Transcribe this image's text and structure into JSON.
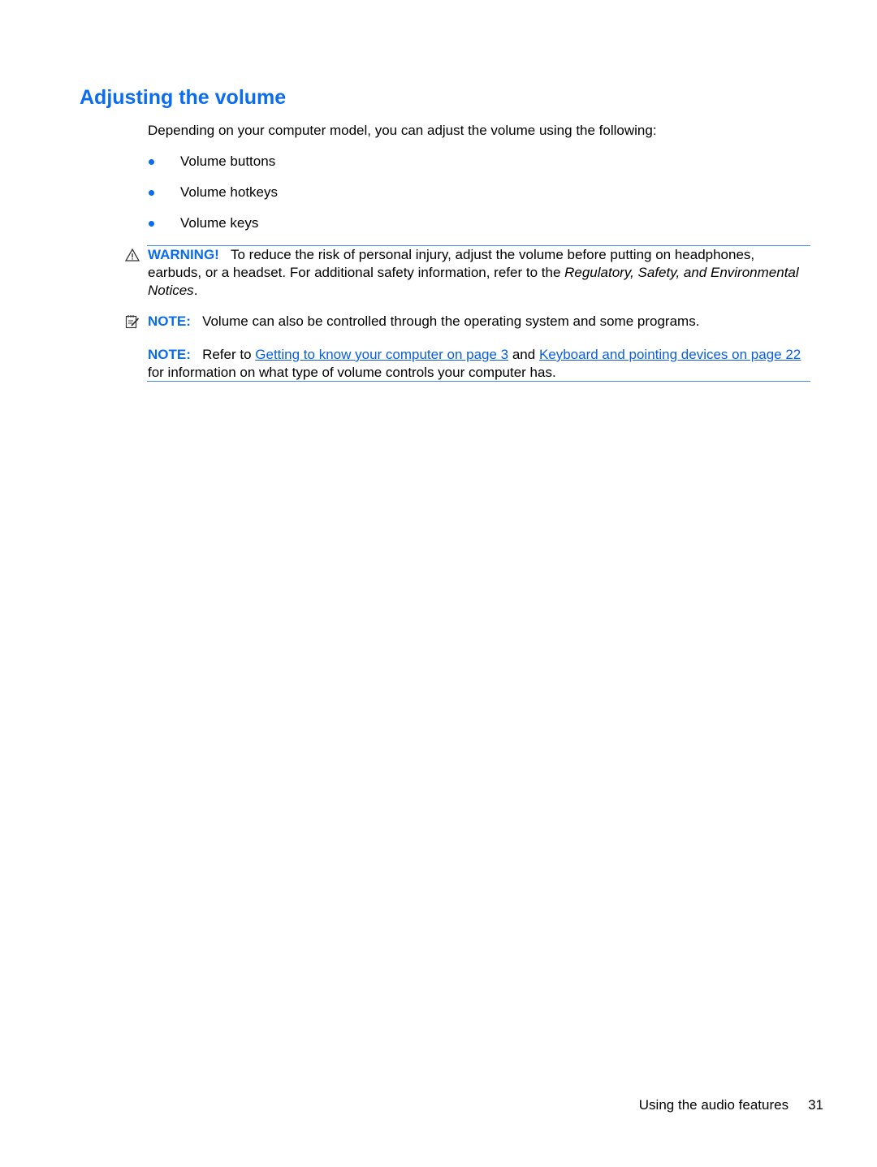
{
  "heading": "Adjusting the volume",
  "intro": "Depending on your computer model, you can adjust the volume using the following:",
  "bullets": [
    "Volume buttons",
    "Volume hotkeys",
    "Volume keys"
  ],
  "warning": {
    "icon": "warning-triangle-icon",
    "label": "WARNING!",
    "text_before": "To reduce the risk of personal injury, adjust the volume before putting on headphones, earbuds, or a headset. For additional safety information, refer to the ",
    "italic": "Regulatory, Safety, and Environmental Notices",
    "text_after": "."
  },
  "note1": {
    "icon": "note-icon",
    "label": "NOTE:",
    "text": "Volume can also be controlled through the operating system and some programs."
  },
  "note2": {
    "label": "NOTE:",
    "text_before": "Refer to ",
    "link1": "Getting to know your computer on page 3",
    "text_mid": " and ",
    "link2": "Keyboard and pointing devices on page 22",
    "text_after": " for information on what type of volume controls your computer has."
  },
  "footer": {
    "section": "Using the audio features",
    "page_number": "31"
  },
  "colors": {
    "accent": "#0a6cf0",
    "rule": "#4a8de8"
  }
}
